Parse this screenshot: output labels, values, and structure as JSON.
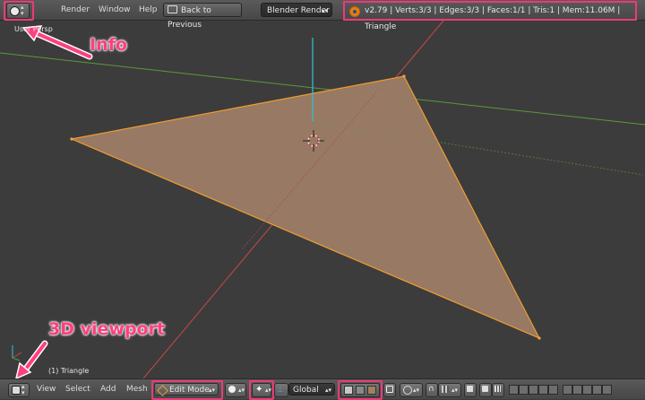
{
  "info_header": {
    "menus": [
      "Render",
      "Window",
      "Help"
    ],
    "back_button": "Back to Previous",
    "render_engine": "Blender Render",
    "stats": "v2.79 | Verts:3/3 | Edges:3/3 | Faces:1/1 | Tris:1 | Mem:11.06M | Triangle"
  },
  "viewport": {
    "view_label": "User Persp",
    "object_label": "(1) Triangle"
  },
  "annotations": {
    "info": "Info",
    "viewport": "3D viewport"
  },
  "bottom_header": {
    "menus": [
      "View",
      "Select",
      "Add",
      "Mesh"
    ],
    "mode": "Edit Mode",
    "orientation": "Global"
  },
  "colors": {
    "face": "#9c7c66",
    "edge": "#f09c30",
    "highlight": "#ec3a78",
    "grid_x": "#c84848",
    "grid_y": "#5a9a3a",
    "z_axis": "#2ec6d6"
  }
}
